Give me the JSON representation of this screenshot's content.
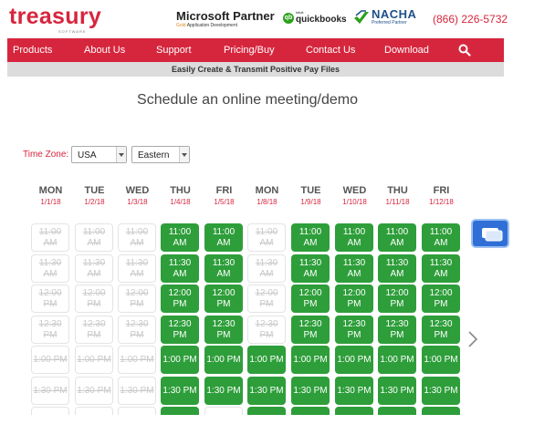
{
  "header": {
    "logo_text": "treasury",
    "logo_sub": "SOFTWARE",
    "partner_title": "Microsoft Partner",
    "partner_level": "Gold",
    "partner_area": "Application Development",
    "qb_prefix": "intuit",
    "qb_name": "quickbooks",
    "nacha_title": "NACHA",
    "nacha_sub": "Preferred Partner",
    "phone": "(866) 226-5732"
  },
  "nav": {
    "items": [
      "Products",
      "About Us",
      "Support",
      "Pricing/Buy",
      "Contact Us",
      "Download"
    ],
    "search_icon": "search-icon"
  },
  "subbar": "Easily Create & Transmit Positive Pay Files",
  "page_title": "Schedule an online meeting/demo",
  "timezone": {
    "label": "Time Zone:",
    "country": "USA",
    "zone": "Eastern"
  },
  "days": [
    {
      "name": "MON",
      "date": "1/1/18"
    },
    {
      "name": "TUE",
      "date": "1/2/18"
    },
    {
      "name": "WED",
      "date": "1/3/18"
    },
    {
      "name": "THU",
      "date": "1/4/18"
    },
    {
      "name": "FRI",
      "date": "1/5/18"
    },
    {
      "name": "MON",
      "date": "1/8/18"
    },
    {
      "name": "TUE",
      "date": "1/9/18"
    },
    {
      "name": "WED",
      "date": "1/10/18"
    },
    {
      "name": "THU",
      "date": "1/11/18"
    },
    {
      "name": "FRI",
      "date": "1/12/18"
    }
  ],
  "time_rows": [
    {
      "top": "11:00",
      "bottom": "AM",
      "available": [
        false,
        false,
        false,
        true,
        true,
        false,
        true,
        true,
        true,
        true
      ]
    },
    {
      "top": "11:30",
      "bottom": "AM",
      "available": [
        false,
        false,
        false,
        true,
        true,
        false,
        true,
        true,
        true,
        true
      ]
    },
    {
      "top": "12:00",
      "bottom": "PM",
      "available": [
        false,
        false,
        false,
        true,
        true,
        false,
        true,
        true,
        true,
        true
      ]
    },
    {
      "top": "12:30",
      "bottom": "PM",
      "available": [
        false,
        false,
        false,
        true,
        true,
        false,
        true,
        true,
        true,
        true
      ]
    },
    {
      "top": "1:00 PM",
      "bottom": "",
      "available": [
        false,
        false,
        false,
        true,
        true,
        true,
        true,
        true,
        true,
        true
      ]
    },
    {
      "top": "1:30 PM",
      "bottom": "",
      "available": [
        false,
        false,
        false,
        true,
        true,
        true,
        true,
        true,
        true,
        true
      ]
    },
    {
      "top": "",
      "bottom": "",
      "available": [
        false,
        false,
        false,
        true,
        false,
        true,
        true,
        true,
        true,
        true
      ]
    }
  ],
  "colors": {
    "brand_red": "#d6263d",
    "available_green": "#2e9e3a",
    "chat_blue": "#2f6fd6"
  },
  "icons": {
    "next": "chevron-right-icon",
    "chat": "chat-bubble-icon",
    "search": "search-icon"
  }
}
